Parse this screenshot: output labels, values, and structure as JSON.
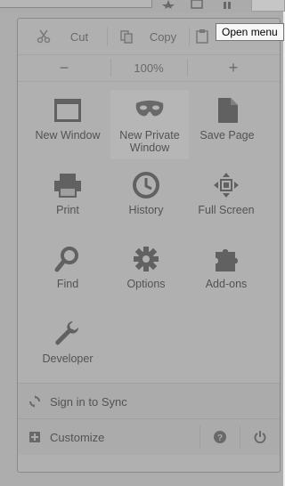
{
  "tooltip": {
    "open_menu": "Open menu"
  },
  "edit": {
    "cut": "Cut",
    "copy": "Copy"
  },
  "zoom": {
    "minus": "−",
    "value": "100%",
    "plus": "+"
  },
  "grid": [
    {
      "label": "New Window",
      "icon": "window-icon"
    },
    {
      "label": "New Private Window",
      "icon": "mask-icon"
    },
    {
      "label": "Save Page",
      "icon": "page-icon"
    },
    {
      "label": "Print",
      "icon": "printer-icon"
    },
    {
      "label": "History",
      "icon": "clock-icon"
    },
    {
      "label": "Full Screen",
      "icon": "fullscreen-icon"
    },
    {
      "label": "Find",
      "icon": "magnifier-icon"
    },
    {
      "label": "Options",
      "icon": "gear-icon"
    },
    {
      "label": "Add-ons",
      "icon": "puzzle-icon"
    },
    {
      "label": "Developer",
      "icon": "wrench-icon"
    }
  ],
  "footer": {
    "sync": "Sign in to Sync",
    "customize": "Customize"
  }
}
